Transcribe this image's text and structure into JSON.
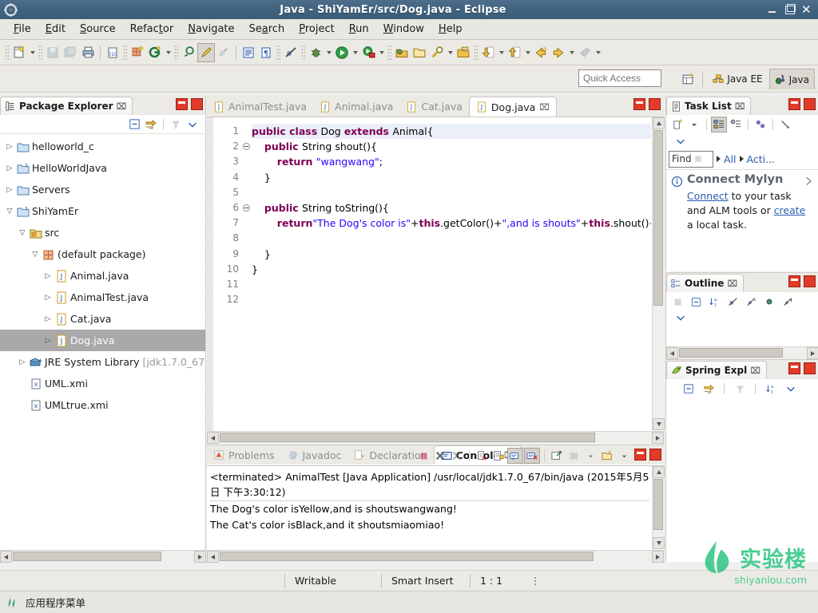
{
  "window": {
    "title": "Java - ShiYamEr/src/Dog.java - Eclipse",
    "app_icon": "eclipse-icon",
    "minimize": "–",
    "maximize": "□",
    "close": "✕"
  },
  "menu": {
    "items": [
      {
        "label": "File",
        "mnemonic": "F"
      },
      {
        "label": "Edit",
        "mnemonic": "E"
      },
      {
        "label": "Source",
        "mnemonic": "S"
      },
      {
        "label": "Refactor",
        "mnemonic": "t"
      },
      {
        "label": "Navigate",
        "mnemonic": "N"
      },
      {
        "label": "Search",
        "mnemonic": "a"
      },
      {
        "label": "Project",
        "mnemonic": "P"
      },
      {
        "label": "Run",
        "mnemonic": "R"
      },
      {
        "label": "Window",
        "mnemonic": "W"
      },
      {
        "label": "Help",
        "mnemonic": "H"
      }
    ]
  },
  "toolbar": {
    "buttons": [
      "new-wizard-icon",
      "new-dropdown-arrow",
      "save-icon",
      "save-all-icon",
      "print-icon",
      "separator",
      "toggle-breadcrumb-icon",
      "new-java-package-icon",
      "new-java-class-icon",
      "new-java-class-dropdown",
      "separator",
      "open-type-icon",
      "annotation-icon",
      "toggle-mark-occurrences-icon",
      "separator",
      "outline-view-icon",
      "format-icon",
      "separator",
      "skip-breakpoints-icon",
      "debug-icon",
      "debug-dropdown",
      "run-icon",
      "run-dropdown",
      "run-external-tools-icon",
      "external-tools-dropdown",
      "separator",
      "open-task-icon",
      "open-resource-icon",
      "search-icon",
      "search-dropdown",
      "open-type-hierarchy-icon",
      "separator",
      "next-annotation-icon",
      "next-annotation-dropdown",
      "previous-annotation-icon",
      "previous-annotation-dropdown",
      "back-icon",
      "forward-icon",
      "forward-dropdown",
      "pin-editor-icon",
      "pin-dropdown"
    ]
  },
  "quick_access": {
    "placeholder": "Quick Access",
    "value": "",
    "open_perspective_icon": "open-perspective-icon",
    "perspectives": [
      {
        "label": "Java EE",
        "icon": "java-ee-perspective-icon",
        "active": false
      },
      {
        "label": "Java",
        "icon": "java-perspective-icon",
        "active": true
      }
    ]
  },
  "package_explorer": {
    "title": "Package Explorer",
    "close_glyph": "⌧",
    "toolbar": [
      "collapse-all-icon",
      "link-with-editor-icon",
      "separator",
      "view-menu-filter-icon",
      "view-menu-icon"
    ],
    "tree": [
      {
        "label": "helloworld_c",
        "indent": 0,
        "arrow": "collapsed",
        "icon": "c-project-icon",
        "selected": false
      },
      {
        "label": "HelloWorldJava",
        "indent": 0,
        "arrow": "collapsed",
        "icon": "java-project-icon",
        "selected": false
      },
      {
        "label": "Servers",
        "indent": 0,
        "arrow": "collapsed",
        "icon": "folder-icon",
        "selected": false
      },
      {
        "label": "ShiYamEr",
        "indent": 0,
        "arrow": "expanded",
        "icon": "java-project-icon",
        "selected": false
      },
      {
        "label": "src",
        "indent": 1,
        "arrow": "expanded",
        "icon": "source-folder-icon",
        "selected": false
      },
      {
        "label": "(default package)",
        "indent": 2,
        "arrow": "expanded",
        "icon": "package-icon",
        "selected": false
      },
      {
        "label": "Animal.java",
        "indent": 3,
        "arrow": "collapsed",
        "icon": "java-file-icon",
        "selected": false
      },
      {
        "label": "AnimalTest.java",
        "indent": 3,
        "arrow": "collapsed",
        "icon": "java-file-icon",
        "selected": false
      },
      {
        "label": "Cat.java",
        "indent": 3,
        "arrow": "collapsed",
        "icon": "java-file-icon",
        "selected": false
      },
      {
        "label": "Dog.java",
        "indent": 3,
        "arrow": "collapsed",
        "icon": "java-file-icon",
        "selected": true
      },
      {
        "label": "JRE System Library",
        "suffix": "[jdk1.7.0_67",
        "indent": 1,
        "arrow": "collapsed",
        "icon": "jre-library-icon",
        "selected": false
      },
      {
        "label": "UML.xmi",
        "indent": 1,
        "arrow": "none",
        "icon": "xmi-file-icon",
        "selected": false
      },
      {
        "label": "UMLtrue.xmi",
        "indent": 1,
        "arrow": "none",
        "icon": "xmi-file-icon",
        "selected": false
      }
    ]
  },
  "editor": {
    "tabs": [
      {
        "label": "AnimalTest.java",
        "icon": "java-file-icon",
        "active": false,
        "closeable": false
      },
      {
        "label": "Animal.java",
        "icon": "java-file-icon",
        "active": false,
        "closeable": false
      },
      {
        "label": "Cat.java",
        "icon": "java-file-icon",
        "active": false,
        "closeable": false
      },
      {
        "label": "Dog.java",
        "icon": "java-file-icon",
        "active": true,
        "closeable": true
      }
    ],
    "close_glyph": "⌧",
    "lines": [
      {
        "n": 1,
        "fold": false,
        "current": true,
        "tokens": [
          {
            "t": "public ",
            "c": "kw"
          },
          {
            "t": "class ",
            "c": "kw"
          },
          {
            "t": "Dog ",
            "c": "plain"
          },
          {
            "t": "extends ",
            "c": "kw"
          },
          {
            "t": "Animal{",
            "c": "plain"
          }
        ]
      },
      {
        "n": 2,
        "fold": true,
        "current": false,
        "tokens": [
          {
            "t": "    ",
            "c": "plain"
          },
          {
            "t": "public ",
            "c": "kw"
          },
          {
            "t": "String shout(){",
            "c": "plain"
          }
        ]
      },
      {
        "n": 3,
        "fold": false,
        "current": false,
        "tokens": [
          {
            "t": "        ",
            "c": "plain"
          },
          {
            "t": "return ",
            "c": "kw"
          },
          {
            "t": "\"wangwang\"",
            "c": "str"
          },
          {
            "t": ";",
            "c": "plain"
          }
        ]
      },
      {
        "n": 4,
        "fold": false,
        "current": false,
        "tokens": [
          {
            "t": "    }",
            "c": "plain"
          }
        ]
      },
      {
        "n": 5,
        "fold": false,
        "current": false,
        "tokens": []
      },
      {
        "n": 6,
        "fold": true,
        "current": false,
        "tokens": [
          {
            "t": "    ",
            "c": "plain"
          },
          {
            "t": "public ",
            "c": "kw"
          },
          {
            "t": "String toString(){",
            "c": "plain"
          }
        ]
      },
      {
        "n": 7,
        "fold": false,
        "current": false,
        "tokens": [
          {
            "t": "        ",
            "c": "plain"
          },
          {
            "t": "return",
            "c": "kw"
          },
          {
            "t": "\"The Dog's color is\"",
            "c": "str"
          },
          {
            "t": "+",
            "c": "plain"
          },
          {
            "t": "this",
            "c": "kw"
          },
          {
            "t": ".getColor()+",
            "c": "plain"
          },
          {
            "t": "\",and is shouts\"",
            "c": "str"
          },
          {
            "t": "+",
            "c": "plain"
          },
          {
            "t": "this",
            "c": "kw"
          },
          {
            "t": ".shout()+",
            "c": "plain"
          }
        ]
      },
      {
        "n": 8,
        "fold": false,
        "current": false,
        "tokens": []
      },
      {
        "n": 9,
        "fold": false,
        "current": false,
        "tokens": [
          {
            "t": "    }",
            "c": "plain"
          }
        ]
      },
      {
        "n": 10,
        "fold": false,
        "current": false,
        "tokens": [
          {
            "t": "}",
            "c": "plain"
          }
        ]
      },
      {
        "n": 11,
        "fold": false,
        "current": false,
        "tokens": []
      },
      {
        "n": 12,
        "fold": false,
        "current": false,
        "tokens": []
      }
    ]
  },
  "task_list": {
    "title": "Task List",
    "close_glyph": "⌧",
    "toolbar": [
      "new-task-icon",
      "new-task-dropdown",
      "separator",
      "categorized-presentation-icon",
      "scheduled-presentation-icon",
      "separator",
      "synchronize-changed-icon",
      "separator",
      "focus-on-workweek-icon",
      "view-menu-icon"
    ],
    "find_label": "Find",
    "find_value": "",
    "filters": [
      "All",
      "Acti..."
    ],
    "mylyn": {
      "icon": "info-icon",
      "heading": "Connect Mylyn",
      "link1": "Connect",
      "text1": " to your task and ALM tools or ",
      "link2": "create",
      "text2": " a local task."
    }
  },
  "outline": {
    "title": "Outline",
    "close_glyph": "⌧",
    "toolbar": [
      "focus-on-active-task-icon",
      "collapse-all-icon",
      "sort-icon",
      "hide-fields-icon",
      "hide-static-icon",
      "hide-nonpublic-icon",
      "hide-local-types-icon",
      "view-menu-icon"
    ]
  },
  "spring_explorer": {
    "title": "Spring Expl",
    "close_glyph": "⌧",
    "toolbar": [
      "collapse-all-icon",
      "link-with-editor-icon",
      "separator",
      "filter-icon",
      "separator",
      "sort-icon",
      "view-menu-icon"
    ]
  },
  "bottom_panel": {
    "tabs": [
      {
        "label": "Problems",
        "icon": "problems-icon",
        "active": false
      },
      {
        "label": "Javadoc",
        "icon": "javadoc-icon",
        "active": false
      },
      {
        "label": "Declaration",
        "icon": "declaration-icon",
        "active": false
      },
      {
        "label": "Console",
        "icon": "console-icon",
        "active": true
      }
    ],
    "close_glyph": "⌧",
    "toolbar": [
      "terminate-icon",
      "remove-launch-icon",
      "remove-all-terminated-icon",
      "separator",
      "clear-console-icon",
      "scroll-lock-icon",
      "show-console-on-output-icon",
      "show-console-on-error-icon",
      "separator",
      "pin-console-icon",
      "display-selected-console-icon",
      "display-console-dropdown",
      "open-console-icon",
      "open-console-dropdown"
    ],
    "console": {
      "header": "<terminated> AnimalTest [Java Application] /usr/local/jdk1.7.0_67/bin/java (2015年5月5日 下午3:30:12)",
      "lines": [
        "The Dog's color isYellow,and is shoutswangwang!",
        "The Cat's color isBlack,and it shoutsmiaomiao!"
      ]
    }
  },
  "status_bar": {
    "writable": "Writable",
    "insert_mode": "Smart Insert",
    "position": "1 : 1"
  },
  "taskbar": {
    "icon": "apps-menu-icon",
    "label": "应用程序菜单"
  },
  "watermark": {
    "text": "实验楼",
    "sub": "shiyanlou.com",
    "color": "#3cc98c"
  },
  "colors": {
    "title_bar": "#40637f",
    "chrome": "#eceae5",
    "selection": "#a9a9a9",
    "keyword": "#7f0055",
    "string": "#2a00ff",
    "link": "#2a5db0",
    "close_button": "#e03b2a"
  }
}
